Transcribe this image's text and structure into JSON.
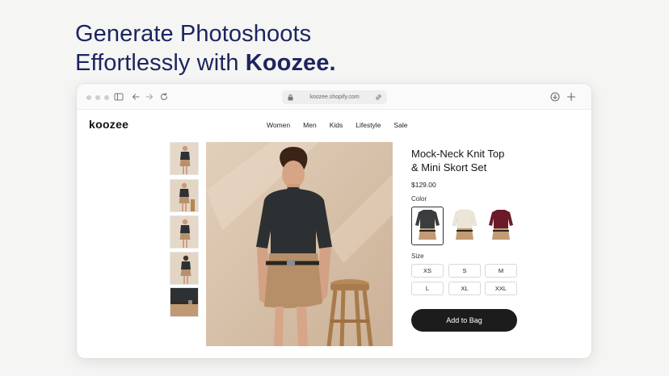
{
  "headline": {
    "line1": "Generate Photoshoots",
    "line2_prefix": "Effortlessly with ",
    "line2_brand": "Koozee."
  },
  "browser": {
    "url": "koozee.shopify.com",
    "icons": [
      "sidebar-icon",
      "back-icon",
      "forward-icon",
      "reload-icon",
      "lock-icon",
      "link-icon",
      "download-icon",
      "new-tab-icon"
    ]
  },
  "shop": {
    "logo": "koozee",
    "nav": [
      "Women",
      "Men",
      "Kids",
      "Lifestyle",
      "Sale"
    ]
  },
  "product": {
    "title_line1": "Mock-Neck Knit Top",
    "title_line2": "& Mini Skort Set",
    "price": "$129.00",
    "color_label": "Color",
    "colors": [
      {
        "name": "charcoal",
        "hex": "#3a3d3e",
        "selected": true
      },
      {
        "name": "cream",
        "hex": "#ece6d9",
        "selected": false
      },
      {
        "name": "burgundy",
        "hex": "#6b1a2a",
        "selected": false
      }
    ],
    "size_label": "Size",
    "sizes": [
      "XS",
      "S",
      "M",
      "L",
      "XL",
      "XXL"
    ],
    "add_to_bag": "Add to Bag"
  },
  "colors": {
    "headline": "#1d2560",
    "button": "#1c1c1c",
    "photo_background": "#d3bca4"
  }
}
